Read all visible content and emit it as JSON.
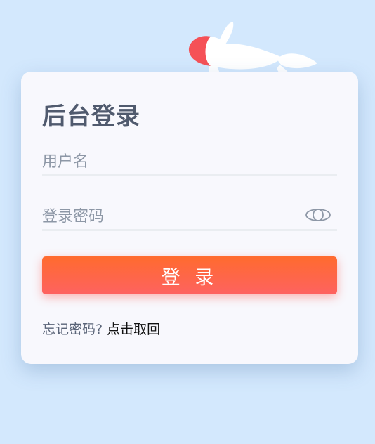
{
  "login": {
    "title": "后台登录",
    "username_placeholder": "用户名",
    "username_value": "",
    "password_placeholder": "登录密码",
    "password_value": "",
    "submit_label": "登 录",
    "forgot_text": "忘记密码?",
    "forgot_link": "点击取回"
  },
  "icons": {
    "password_toggle": "eye-icon",
    "decoration": "koi-fish-icon"
  },
  "colors": {
    "background": "#d3e8fd",
    "card": "#f8f8fd",
    "title": "#505a6e",
    "button_start": "#ff6b2e",
    "button_end": "#fe6260",
    "koi_red": "#f55157"
  }
}
